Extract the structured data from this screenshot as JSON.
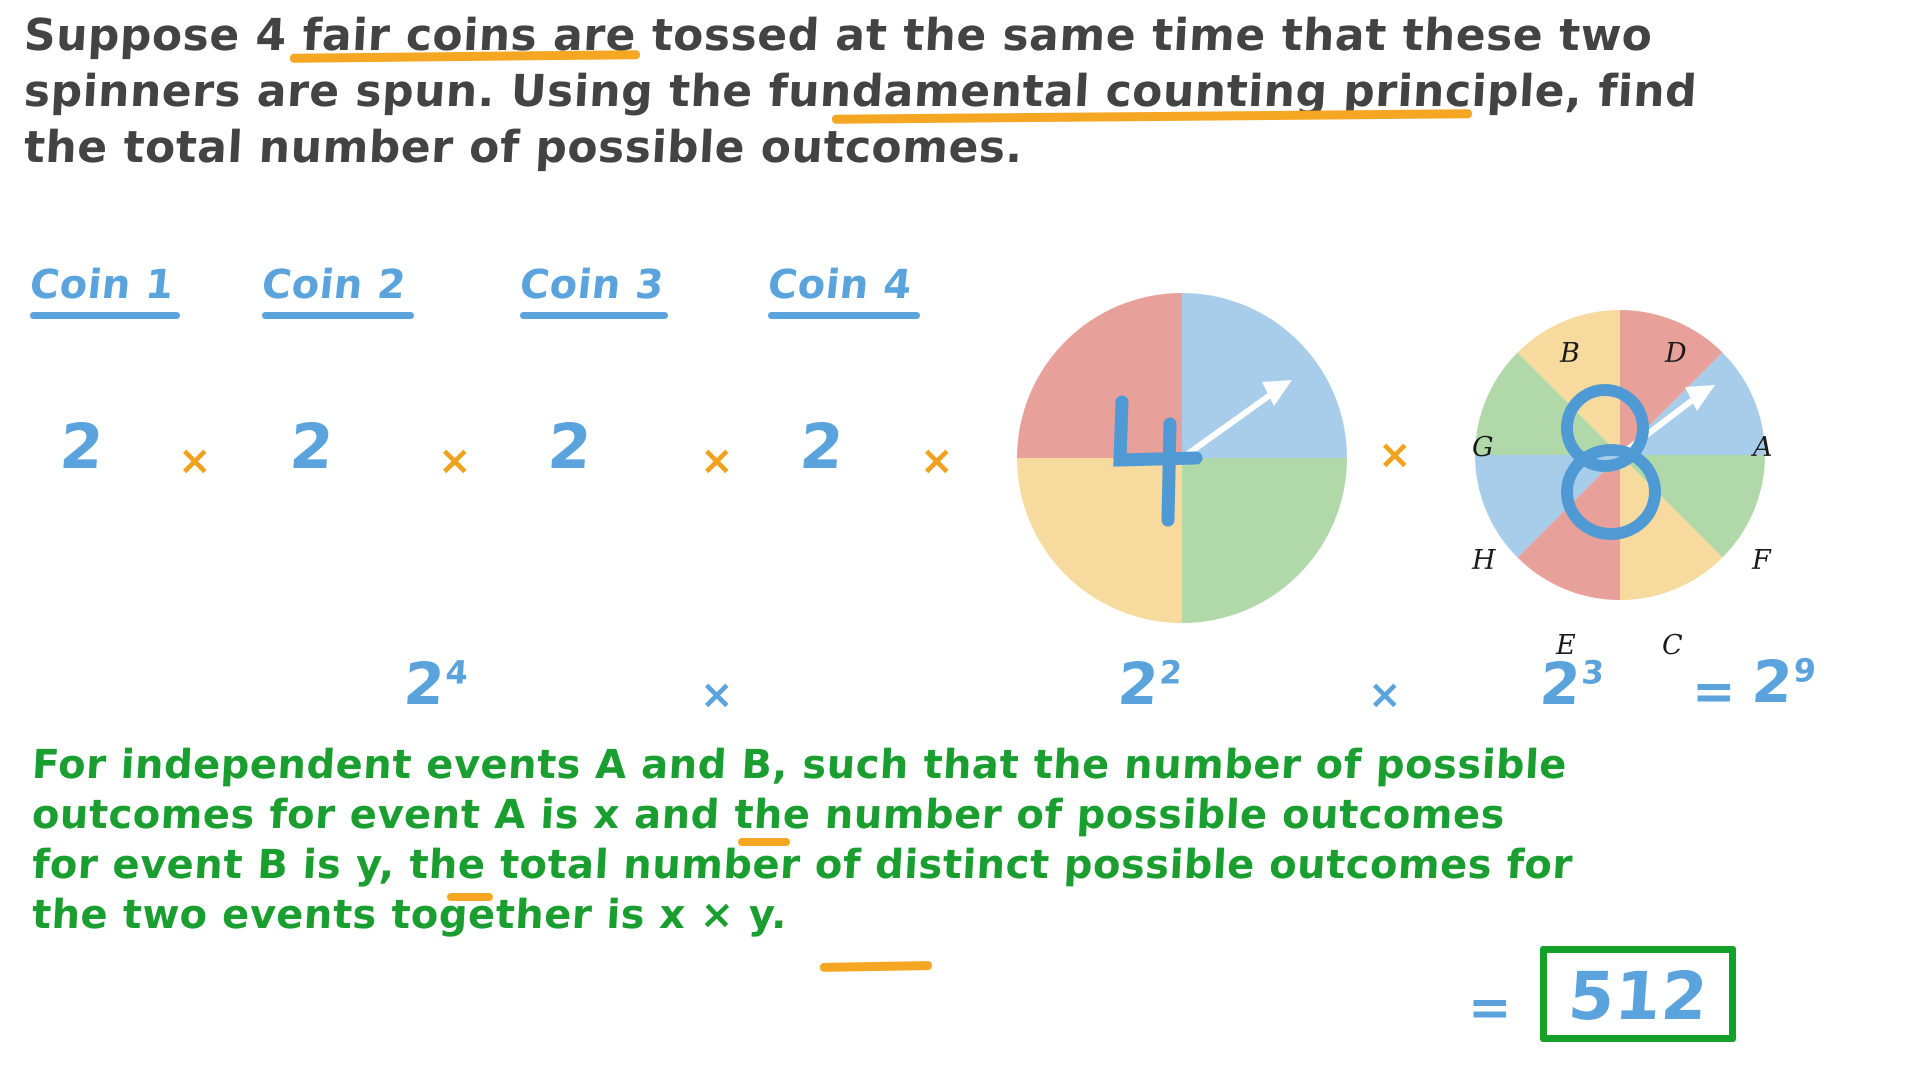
{
  "question": {
    "lines": [
      "Suppose 4 fair coins are tossed at the same time that these two",
      "spinners are spun. Using the fundamental counting principle, find",
      "the total number of possible outcomes."
    ],
    "highlighted_phrases": [
      "4 fair coins",
      "fundamental counting principle"
    ]
  },
  "coins": {
    "labels": [
      "Coin 1",
      "Coin 2",
      "Coin 3",
      "Coin 4"
    ],
    "values": [
      "2",
      "2",
      "2",
      "2"
    ],
    "operator": "×"
  },
  "spinners": [
    {
      "name": "spinner-four-sectors",
      "sector_count_annotation": "4",
      "sectors": [
        {
          "label": "",
          "color": "#a8cdea",
          "from_deg": 0,
          "to_deg": 90
        },
        {
          "label": "",
          "color": "#b0d8a8",
          "from_deg": 90,
          "to_deg": 180
        },
        {
          "label": "",
          "color": "#f6da9e",
          "from_deg": 180,
          "to_deg": 270
        },
        {
          "label": "",
          "color": "#e8a09a",
          "from_deg": 270,
          "to_deg": 360
        }
      ],
      "pointer_direction_deg": 55
    },
    {
      "name": "spinner-eight-sectors",
      "sector_count_annotation": "8",
      "sectors": [
        {
          "label": "D",
          "color": "#e8a09a",
          "from_deg": 0,
          "to_deg": 45
        },
        {
          "label": "A",
          "color": "#a8cdea",
          "from_deg": 45,
          "to_deg": 90
        },
        {
          "label": "F",
          "color": "#b0d8a8",
          "from_deg": 90,
          "to_deg": 135
        },
        {
          "label": "C",
          "color": "#f6da9e",
          "from_deg": 135,
          "to_deg": 180
        },
        {
          "label": "E",
          "color": "#e8a09a",
          "from_deg": 180,
          "to_deg": 225
        },
        {
          "label": "H",
          "color": "#a8cdea",
          "from_deg": 225,
          "to_deg": 270
        },
        {
          "label": "G",
          "color": "#b0d8a8",
          "from_deg": 270,
          "to_deg": 315
        },
        {
          "label": "B",
          "color": "#f6da9e",
          "from_deg": 315,
          "to_deg": 360
        }
      ],
      "pointer_direction_deg": 62
    }
  ],
  "spinner_operator": "×",
  "expression": {
    "coins_power": "2",
    "coins_exponent": "4",
    "op1": "×",
    "spinner1_power": "2",
    "spinner1_exponent": "2",
    "op2": "×",
    "spinner2_power": "2",
    "spinner2_exponent": "3",
    "equals": "=",
    "result_power": "2",
    "result_exponent": "9"
  },
  "note": {
    "lines": [
      "For independent events A and B, such that the number of possible",
      "outcomes for event A is x and the number of possible outcomes",
      "for event B is y, the total number of distinct possible outcomes for",
      " the two events together is x × y."
    ],
    "underlined_terms": [
      "x",
      "y",
      "x × y"
    ]
  },
  "answer": {
    "equals": "=",
    "value": "512"
  },
  "colors": {
    "ink_black": "#434343",
    "ink_blue": "#5ba3dd",
    "ink_green": "#1a9e30",
    "ink_orange": "#f5a623",
    "sector_red": "#e8a09a",
    "sector_blue": "#a8cdea",
    "sector_green": "#b0d8a8",
    "sector_yellow": "#f6da9e",
    "answer_box_border": "#15a02a"
  }
}
